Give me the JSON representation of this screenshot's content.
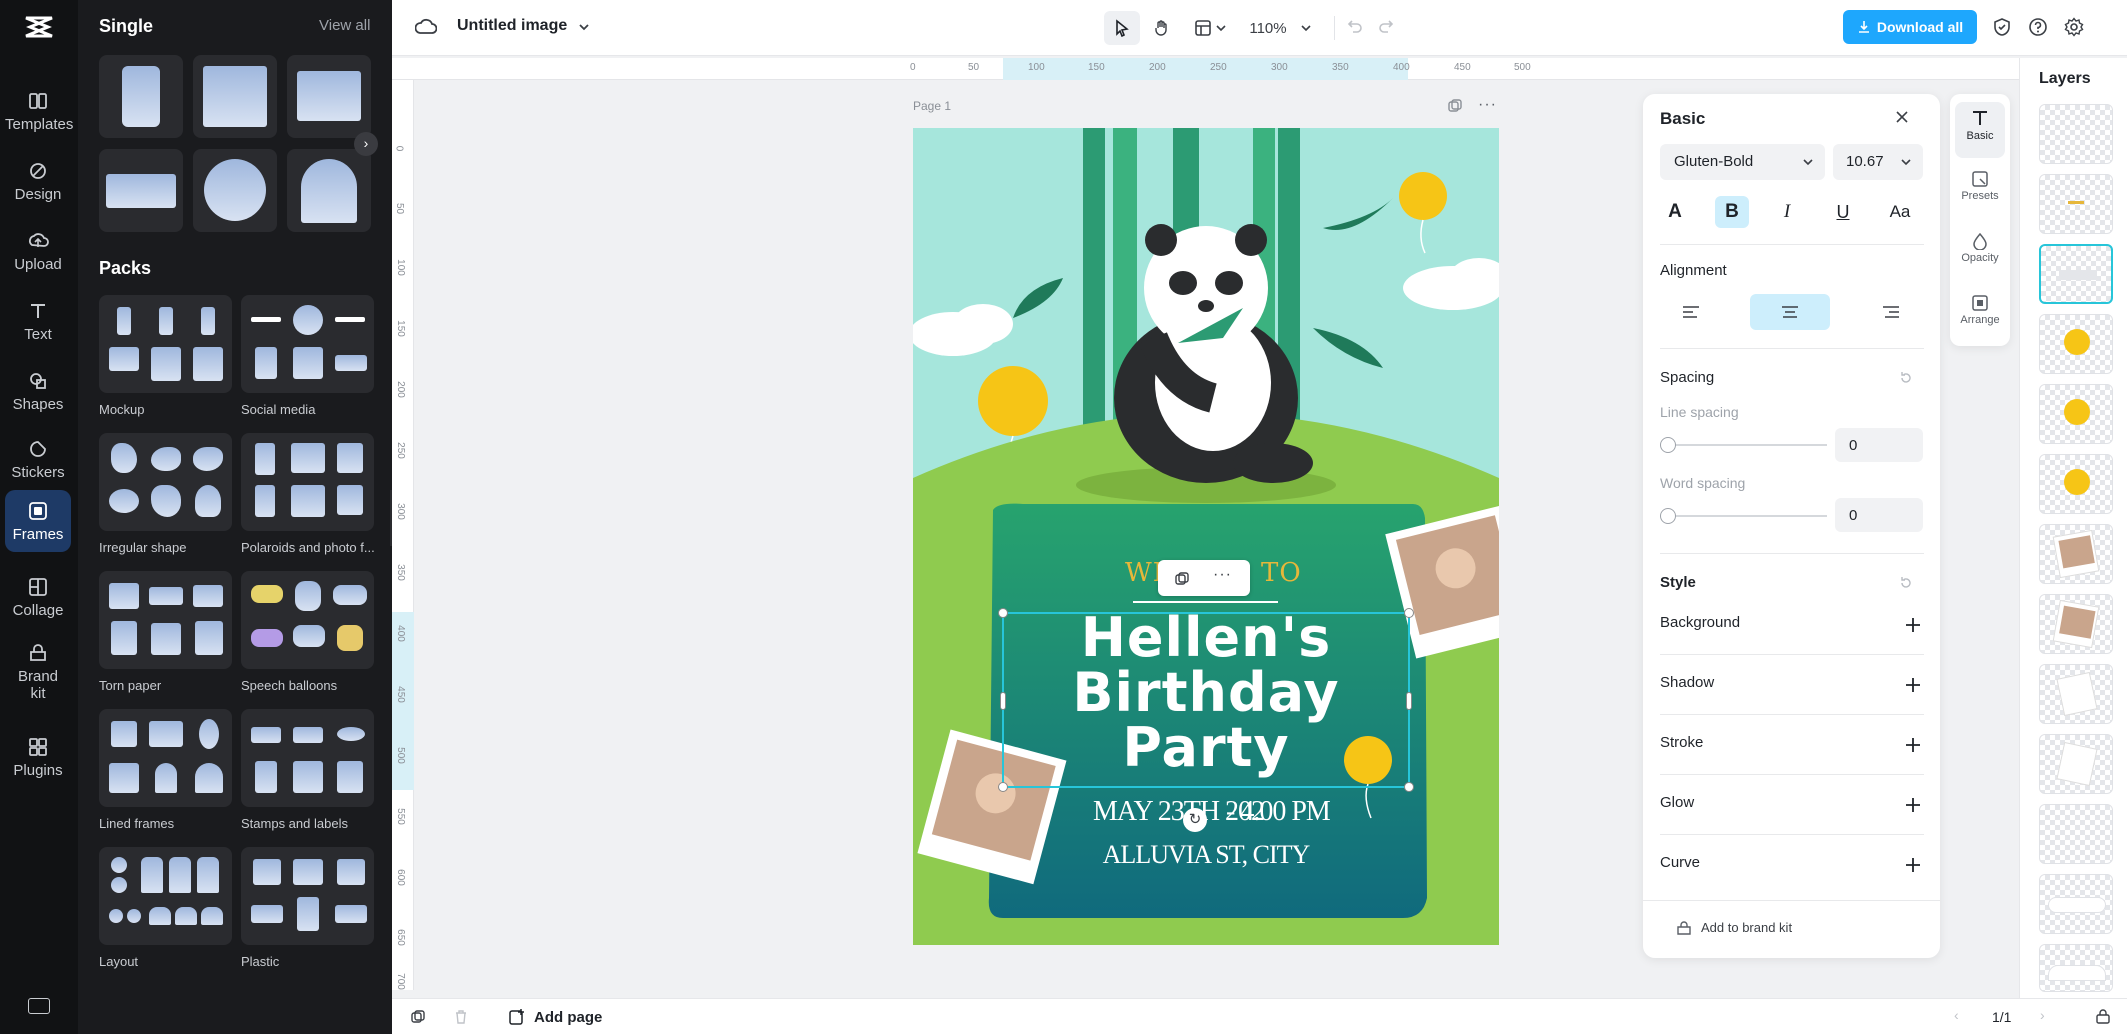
{
  "app": {
    "title": "Untitled image",
    "zoom": "110%",
    "download_label": "Download all"
  },
  "rail": {
    "items": [
      {
        "label": "Templates"
      },
      {
        "label": "Design"
      },
      {
        "label": "Upload"
      },
      {
        "label": "Text"
      },
      {
        "label": "Shapes"
      },
      {
        "label": "Stickers"
      },
      {
        "label": "Frames"
      },
      {
        "label": "Collage"
      },
      {
        "label": "Brand kit"
      },
      {
        "label": "Plugins"
      }
    ]
  },
  "panel": {
    "single_title": "Single",
    "view_all": "View all",
    "packs_title": "Packs",
    "packs": [
      "Mockup",
      "Social media",
      "Irregular shape",
      "Polaroids and photo f...",
      "Torn paper",
      "Speech balloons",
      "Lined frames",
      "Stamps and labels",
      "Layout",
      "Plastic"
    ]
  },
  "canvas": {
    "page_label": "Page 1",
    "ruler_top": [
      "0",
      "50",
      "100",
      "150",
      "200",
      "250",
      "300",
      "350",
      "400",
      "450",
      "500"
    ],
    "ruler_left": [
      "0",
      "50",
      "100",
      "150",
      "200",
      "250",
      "300",
      "350",
      "400",
      "450",
      "500",
      "550",
      "600",
      "650",
      "700"
    ]
  },
  "poster": {
    "welcome": "WE",
    "welcome_tail": "TO",
    "title_line1": "Hellen's",
    "title_line2": "Birthday",
    "title_line3": "Party",
    "date": "MAY 23TH 202",
    "date_tail": "- 4.00 PM",
    "address": "ALLUVIA ST, CITY"
  },
  "props": {
    "title": "Basic",
    "font": "Gluten-Bold",
    "size": "10.67",
    "alignment_label": "Alignment",
    "spacing_label": "Spacing",
    "line_spacing_label": "Line spacing",
    "line_spacing_value": "0",
    "word_spacing_label": "Word spacing",
    "word_spacing_value": "0",
    "style_label": "Style",
    "styles": [
      "Background",
      "Shadow",
      "Stroke",
      "Glow",
      "Curve"
    ],
    "brand_kit": "Add to brand kit"
  },
  "sidetools": {
    "items": [
      "Basic",
      "Presets",
      "Opacity",
      "Arrange"
    ]
  },
  "layers": {
    "title": "Layers"
  },
  "bottom": {
    "add_page": "Add page",
    "pagination": "1/1"
  },
  "colors": {
    "accent": "#1ea7fd",
    "panel_bg": "#1a1b1e",
    "poster_green": "#8fcb4f",
    "poster_teal": "#1f8a7a"
  }
}
